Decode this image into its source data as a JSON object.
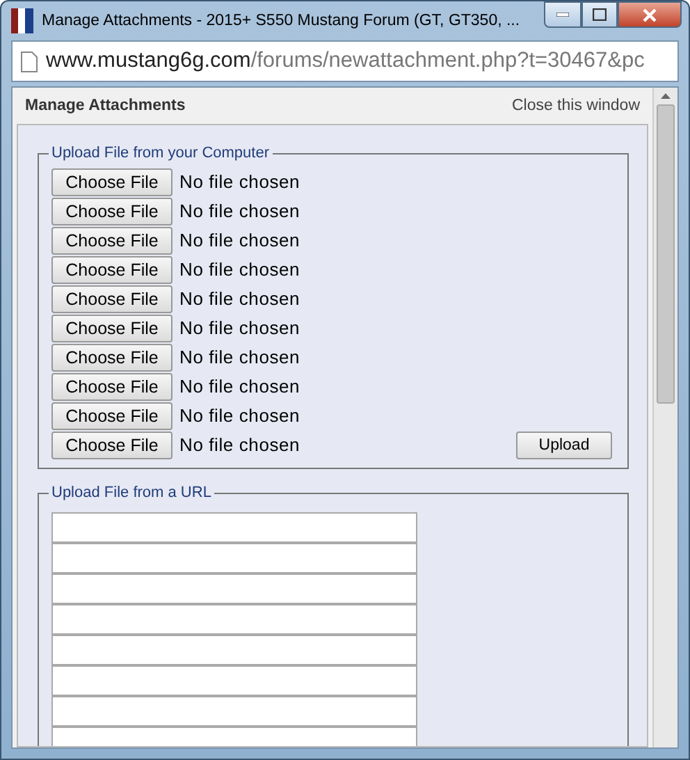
{
  "window": {
    "title": "Manage Attachments - 2015+ S550 Mustang Forum (GT, GT350, ..."
  },
  "address_bar": {
    "domain": "www.mustang6g.com",
    "path": "/forums/newattachment.php?t=30467&pc"
  },
  "page": {
    "heading": "Manage Attachments",
    "close_link": "Close this window"
  },
  "computer_upload": {
    "legend": "Upload File from your Computer",
    "upload_button": "Upload",
    "files": [
      {
        "button": "Choose File",
        "status": "No file chosen"
      },
      {
        "button": "Choose File",
        "status": "No file chosen"
      },
      {
        "button": "Choose File",
        "status": "No file chosen"
      },
      {
        "button": "Choose File",
        "status": "No file chosen"
      },
      {
        "button": "Choose File",
        "status": "No file chosen"
      },
      {
        "button": "Choose File",
        "status": "No file chosen"
      },
      {
        "button": "Choose File",
        "status": "No file chosen"
      },
      {
        "button": "Choose File",
        "status": "No file chosen"
      },
      {
        "button": "Choose File",
        "status": "No file chosen"
      },
      {
        "button": "Choose File",
        "status": "No file chosen"
      }
    ]
  },
  "url_upload": {
    "legend": "Upload File from a URL",
    "fields": [
      {
        "kind": "text"
      },
      {
        "kind": "text"
      },
      {
        "kind": "text"
      },
      {
        "kind": "text"
      },
      {
        "kind": "text"
      },
      {
        "kind": "text"
      },
      {
        "kind": "text"
      },
      {
        "kind": "text"
      }
    ]
  }
}
